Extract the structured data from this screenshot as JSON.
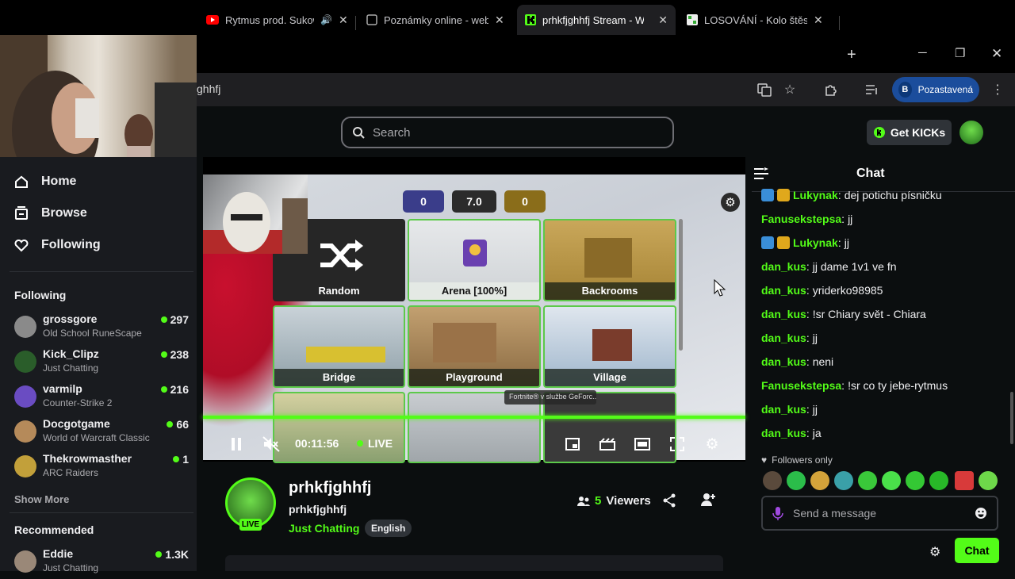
{
  "browser": {
    "tabs": [
      {
        "title": "Rytmus prod. Sukow",
        "icon": "youtube-icon"
      },
      {
        "title": "Poznámky online - webo",
        "icon": "notes-icon"
      },
      {
        "title": "prhkfjghhfj Stream - Wat",
        "icon": "kick-icon"
      },
      {
        "title": "LOSOVÁNÍ - Kolo štěstí",
        "icon": "wheel-icon"
      }
    ],
    "new_tab": "+",
    "url": "ghhfj",
    "profile_initial": "B",
    "profile_label": "Pozastavená"
  },
  "header": {
    "search_placeholder": "Search",
    "get_kicks_label": "Get KICKs"
  },
  "sidebar": {
    "nav": [
      {
        "label": "Home",
        "icon": "home-icon"
      },
      {
        "label": "Browse",
        "icon": "browse-icon"
      },
      {
        "label": "Following",
        "icon": "heart-icon"
      }
    ],
    "following_heading": "Following",
    "following": [
      {
        "name": "grossgore",
        "category": "Old School RuneScape",
        "viewers": "297",
        "avatar_color": "#8a8a8a"
      },
      {
        "name": "Kick_Clipz",
        "category": "Just Chatting",
        "viewers": "238",
        "avatar_color": "#2a5d2a"
      },
      {
        "name": "varmilp",
        "category": "Counter-Strike 2",
        "viewers": "216",
        "avatar_color": "#6a4cc2"
      },
      {
        "name": "Docgotgame",
        "category": "World of Warcraft Classic",
        "viewers": "66",
        "avatar_color": "#b58a5a"
      },
      {
        "name": "Thekrowmasther",
        "category": "ARC Raiders",
        "viewers": "1",
        "avatar_color": "#c2a03a"
      }
    ],
    "show_more": "Show More",
    "recommended_heading": "Recommended",
    "recommended": [
      {
        "name": "Eddie",
        "category": "Just Chatting",
        "viewers": "1.3K",
        "avatar_color": "#9a8878"
      }
    ]
  },
  "player": {
    "score_left": "0",
    "score_center": "7.0",
    "score_right": "0",
    "maps": [
      "Random",
      "Arena [100%]",
      "Backrooms",
      "Bridge",
      "Playground",
      "Village"
    ],
    "tooltip": "Fortnite® v službe GeForc...",
    "timecode": "00:11:56",
    "live_label": "LIVE",
    "progress": 1.0
  },
  "stream": {
    "title": "prhkfjghhfj",
    "username": "prhkfjghhfj",
    "category": "Just Chatting",
    "language": "English",
    "live_badge": "LIVE",
    "viewer_count": "5",
    "viewer_label": "Viewers"
  },
  "chat": {
    "title": "Chat",
    "messages": [
      {
        "user": "Lukynak",
        "text": "dej potichu písničku",
        "color": "#53fc18",
        "badges": true
      },
      {
        "user": "Fanusekstepsa",
        "text": "jj",
        "color": "#53fc18",
        "badges": false
      },
      {
        "user": "Lukynak",
        "text": "jj",
        "color": "#53fc18",
        "badges": true
      },
      {
        "user": "dan_kus",
        "text": "jj dame 1v1 ve fn",
        "color": "#53fc18",
        "badges": false
      },
      {
        "user": "dan_kus",
        "text": "yriderko98985",
        "color": "#53fc18",
        "badges": false
      },
      {
        "user": "dan_kus",
        "text": "!sr Chiary svět - Chiara",
        "color": "#53fc18",
        "badges": false
      },
      {
        "user": "dan_kus",
        "text": "jj",
        "color": "#53fc18",
        "badges": false
      },
      {
        "user": "dan_kus",
        "text": "neni",
        "color": "#53fc18",
        "badges": false
      },
      {
        "user": "Fanusekstepsa",
        "text": "!sr co ty jebe-rytmus",
        "color": "#53fc18",
        "badges": false
      },
      {
        "user": "dan_kus",
        "text": "jj",
        "color": "#53fc18",
        "badges": false
      },
      {
        "user": "dan_kus",
        "text": "ja",
        "color": "#53fc18",
        "badges": false
      }
    ],
    "followers_only": "Followers only",
    "input_placeholder": "Send a message",
    "send_label": "Chat"
  }
}
